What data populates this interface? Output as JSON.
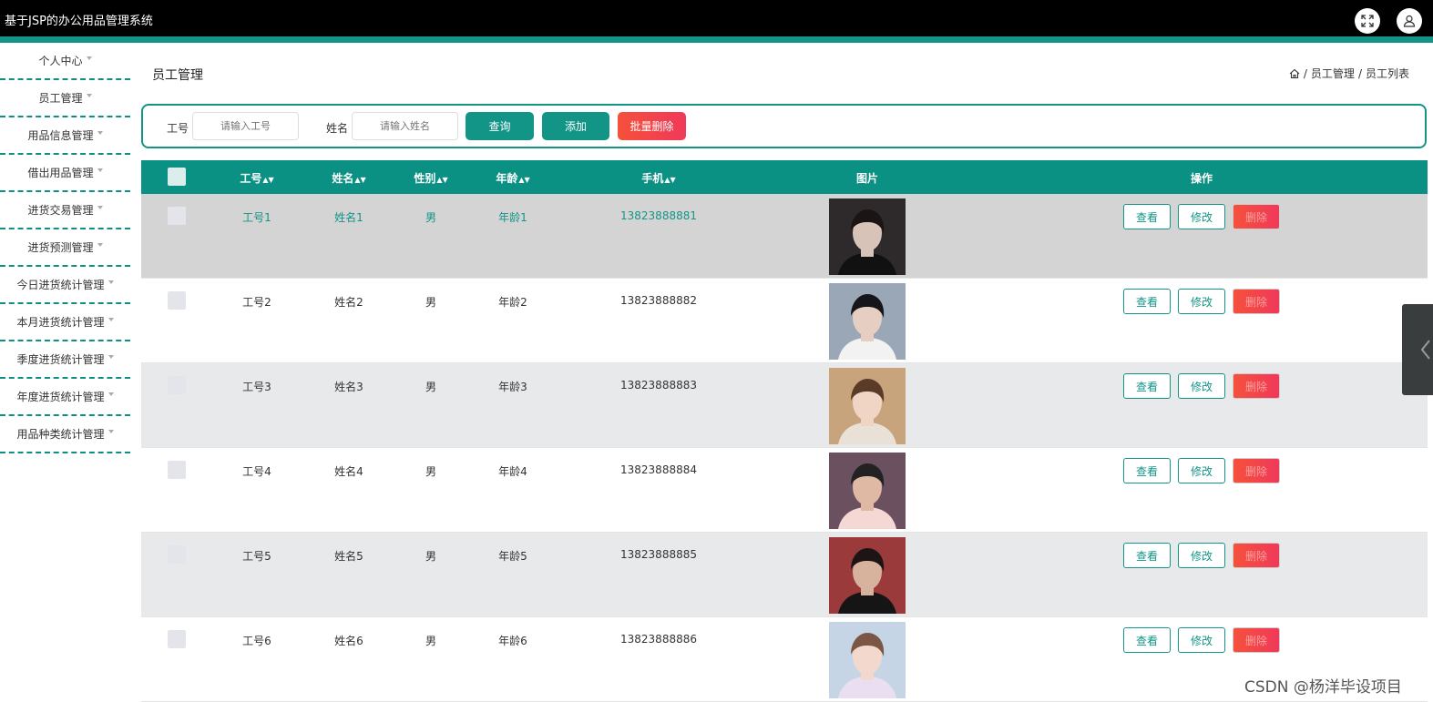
{
  "app": {
    "title": "基于JSP的办公用品管理系统"
  },
  "header": {
    "fullscreen_icon": "expand-icon",
    "user_icon": "user-icon"
  },
  "sidebar": {
    "items": [
      {
        "label": "个人中心"
      },
      {
        "label": "员工管理"
      },
      {
        "label": "用品信息管理"
      },
      {
        "label": "借出用品管理"
      },
      {
        "label": "进货交易管理"
      },
      {
        "label": "进货预测管理"
      },
      {
        "label": "今日进货统计管理"
      },
      {
        "label": "本月进货统计管理"
      },
      {
        "label": "季度进货统计管理"
      },
      {
        "label": "年度进货统计管理"
      },
      {
        "label": "用品种类统计管理"
      }
    ]
  },
  "page": {
    "title": "员工管理",
    "breadcrumb": {
      "home_icon": "home-icon",
      "sep": "/",
      "level1": "员工管理",
      "level2": "员工列表"
    }
  },
  "search": {
    "id_label": "工号",
    "id_placeholder": "请输入工号",
    "name_label": "姓名",
    "name_placeholder": "请输入姓名",
    "query_button": "查询",
    "add_button": "添加",
    "batch_delete_button": "批量删除"
  },
  "table": {
    "headers": {
      "id": "工号",
      "name": "姓名",
      "gender": "性别",
      "age": "年龄",
      "phone": "手机",
      "photo": "图片",
      "actions": "操作"
    },
    "sort_icon": "sort-icon",
    "rows": [
      {
        "id": "工号1",
        "name": "姓名1",
        "gender": "男",
        "age": "年龄1",
        "phone": "13823888881"
      },
      {
        "id": "工号2",
        "name": "姓名2",
        "gender": "男",
        "age": "年龄2",
        "phone": "13823888882"
      },
      {
        "id": "工号3",
        "name": "姓名3",
        "gender": "男",
        "age": "年龄3",
        "phone": "13823888883"
      },
      {
        "id": "工号4",
        "name": "姓名4",
        "gender": "男",
        "age": "年龄4",
        "phone": "13823888884"
      },
      {
        "id": "工号5",
        "name": "姓名5",
        "gender": "男",
        "age": "年龄5",
        "phone": "13823888885"
      },
      {
        "id": "工号6",
        "name": "姓名6",
        "gender": "男",
        "age": "年龄6",
        "phone": "13823888886"
      }
    ],
    "actions": {
      "view": "查看",
      "edit": "修改",
      "delete": "删除"
    }
  },
  "watermark": "CSDN @杨洋毕设项目",
  "colors": {
    "accent": "#129487",
    "danger": "#f24a4a",
    "topbar": "#000000"
  }
}
